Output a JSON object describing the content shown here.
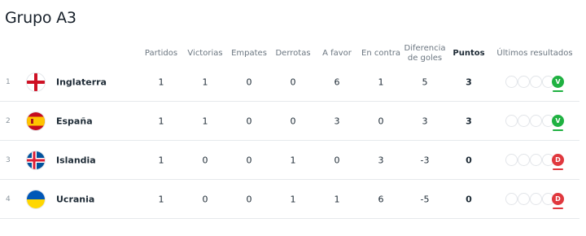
{
  "group_title": "Grupo A3",
  "columns": {
    "played": "Partidos",
    "wins": "Victorias",
    "draws": "Empates",
    "losses": "Derrotas",
    "goals_for": "A favor",
    "goals_against": "En contra",
    "goal_diff": "Diferencia de goles",
    "points": "Puntos",
    "last_results": "Últimos resultados"
  },
  "colors": {
    "win": "#1fb141",
    "loss": "#e0383e"
  },
  "rows": [
    {
      "rank": "1",
      "team": "Inglaterra",
      "flag": "england-flag-icon",
      "played": "1",
      "wins": "1",
      "draws": "0",
      "losses": "0",
      "goals_for": "6",
      "goals_against": "1",
      "goal_diff": "5",
      "points": "3",
      "last_result": "V",
      "last_result_type": "win"
    },
    {
      "rank": "2",
      "team": "España",
      "flag": "spain-flag-icon",
      "played": "1",
      "wins": "1",
      "draws": "0",
      "losses": "0",
      "goals_for": "3",
      "goals_against": "0",
      "goal_diff": "3",
      "points": "3",
      "last_result": "V",
      "last_result_type": "win"
    },
    {
      "rank": "3",
      "team": "Islandia",
      "flag": "iceland-flag-icon",
      "played": "1",
      "wins": "0",
      "draws": "0",
      "losses": "1",
      "goals_for": "0",
      "goals_against": "3",
      "goal_diff": "-3",
      "points": "0",
      "last_result": "D",
      "last_result_type": "loss"
    },
    {
      "rank": "4",
      "team": "Ucrania",
      "flag": "ukraine-flag-icon",
      "played": "1",
      "wins": "0",
      "draws": "0",
      "losses": "1",
      "goals_for": "1",
      "goals_against": "6",
      "goal_diff": "-5",
      "points": "0",
      "last_result": "D",
      "last_result_type": "loss"
    }
  ]
}
